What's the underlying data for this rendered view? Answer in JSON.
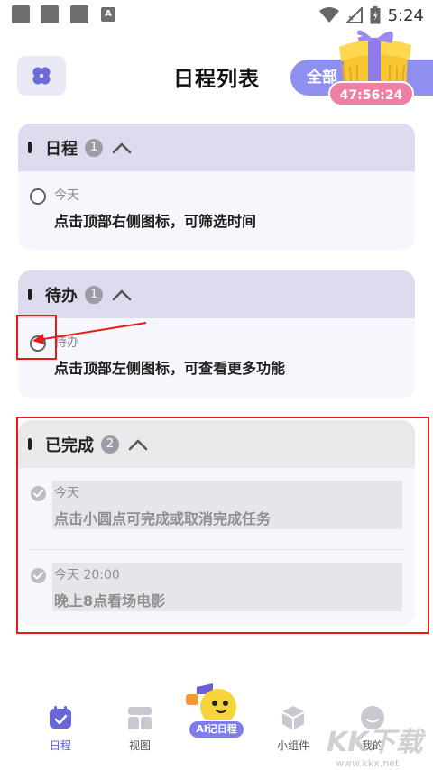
{
  "status_bar": {
    "time": "5:24",
    "notif_letter": "A"
  },
  "header": {
    "title": "日程列表",
    "filter_label": "全部",
    "countdown": "47:56:24"
  },
  "sections": [
    {
      "title": "日程",
      "count": "1",
      "tasks": [
        {
          "date": "今天",
          "text": "点击顶部右侧图标，可筛选时间"
        }
      ]
    },
    {
      "title": "待办",
      "count": "1",
      "tasks": [
        {
          "date": "待办",
          "text": "点击顶部左侧图标，可查看更多功能"
        }
      ]
    },
    {
      "title": "已完成",
      "count": "2",
      "tasks": [
        {
          "date": "今天",
          "text": "点击小圆点可完成或取消完成任务"
        },
        {
          "date": "今天 20:00",
          "text": "晚上8点看场电影"
        }
      ]
    }
  ],
  "tabs": {
    "schedule": "日程",
    "view": "视图",
    "ai": "AI记日程",
    "widgets": "小组件",
    "mine": "我的"
  },
  "watermark": {
    "main": "KK下载",
    "sub": "www.kkx.net"
  },
  "colors": {
    "accent": "#8f8ff0",
    "section_header": "#dcdcee",
    "card_bg": "#f6f6fd",
    "annotation_red": "#e81b1b",
    "countdown_pink": "#ef7fa4"
  },
  "icons": {
    "menu": "four-petal-menu-icon",
    "collapse": "chevron-up-icon",
    "done": "check-circle-icon",
    "promo": "gift-box-icon"
  }
}
